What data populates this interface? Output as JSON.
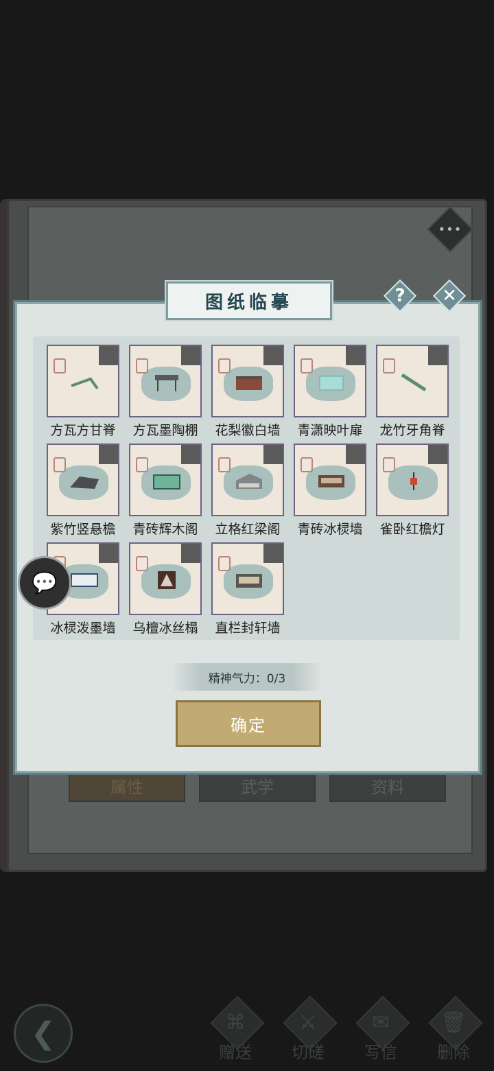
{
  "background": {
    "tabs": [
      {
        "label": "属性",
        "active": true
      },
      {
        "label": "武学",
        "active": false
      },
      {
        "label": "资料",
        "active": false
      }
    ]
  },
  "dialog": {
    "title": "图纸临摹",
    "help_icon": "question-icon",
    "close_icon": "close-icon",
    "items": [
      {
        "label": "方瓦方甘脊"
      },
      {
        "label": "方瓦墨陶棚"
      },
      {
        "label": "花梨徽白墙"
      },
      {
        "label": "青潇映叶扉"
      },
      {
        "label": "龙竹牙角脊"
      },
      {
        "label": "紫竹竖悬檐"
      },
      {
        "label": "青砖辉木阁"
      },
      {
        "label": "立格红梁阁"
      },
      {
        "label": "青砖冰棂墙"
      },
      {
        "label": "雀卧红檐灯"
      },
      {
        "label": "冰棂泼墨墙"
      },
      {
        "label": "乌檀冰丝榻"
      },
      {
        "label": "直栏封轩墙"
      }
    ],
    "energy": "精神气力：0/3",
    "confirm_label": "确定"
  },
  "bottom_bar": {
    "actions": [
      {
        "label": "赠送",
        "icon": "gift-scroll-icon"
      },
      {
        "label": "切磋",
        "icon": "sword-icon"
      },
      {
        "label": "写信",
        "icon": "letter-icon"
      },
      {
        "label": "删除",
        "icon": "trash-icon"
      }
    ]
  },
  "colors": {
    "dialog_bg": "#dde4e2",
    "title_text": "#244650",
    "confirm_bg": "#c2aa73",
    "card_border": "#6d6184"
  }
}
